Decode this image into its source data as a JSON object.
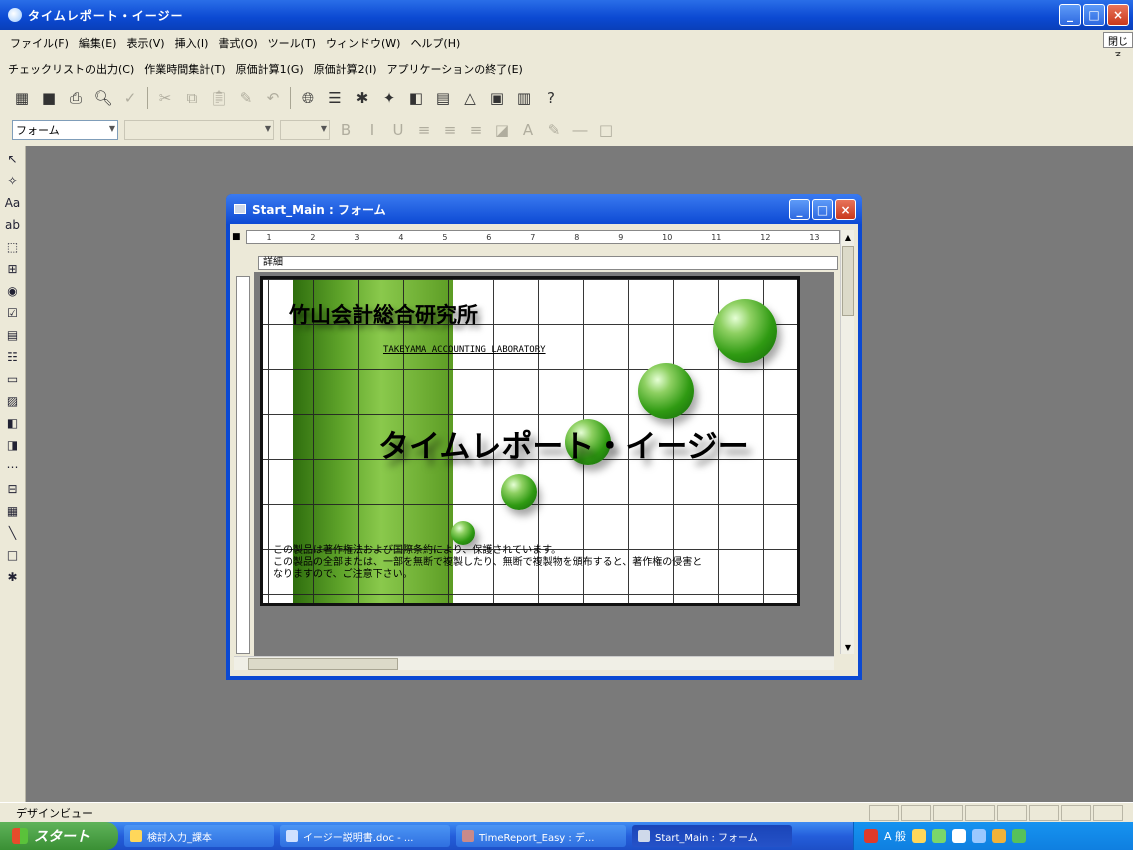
{
  "app": {
    "title": "タイムレポート・イージー"
  },
  "window_buttons": {
    "minimize": "_",
    "maximize": "□",
    "close": "×"
  },
  "menu": [
    "ファイル(F)",
    "編集(E)",
    "表示(V)",
    "挿入(I)",
    "書式(O)",
    "ツール(T)",
    "ウィンドウ(W)",
    "ヘルプ(H)"
  ],
  "ime_close": "閉じる",
  "addin_menu": [
    "チェックリストの出力(C)",
    "作業時間集計(T)",
    "原価計算1(G)",
    "原価計算2(I)",
    "アプリケーションの終了(E)"
  ],
  "format_toolbar": {
    "object_combo": "フォーム"
  },
  "form_window": {
    "title": "Start_Main : フォーム",
    "section": "詳細",
    "ruler_marks": [
      "1",
      "2",
      "3",
      "4",
      "5",
      "6",
      "7",
      "8",
      "9",
      "10",
      "11",
      "12",
      "13"
    ]
  },
  "splash": {
    "company": "竹山会計総合研究所",
    "company_en": "TAKEYAMA ACCOUNTING LABORATORY",
    "title": "タイムレポート・イージー",
    "notice_lines": [
      "この製品は著作権法および国際条約により、保護されています。",
      "この製品の全部または、一部を無断で複製したり、無断で複製物を頒布すると、著作権の侵害と",
      "なりますので、ご注意下さい。"
    ]
  },
  "status": {
    "text": "デザインビュー"
  },
  "taskbar": {
    "start": "スタート",
    "tasks": [
      "検討入力_課本",
      "イージー説明書.doc - ...",
      "TimeReport_Easy : デ...",
      "Start_Main : フォーム"
    ],
    "tray_text": "A 般"
  },
  "colors": {
    "titlebar": "#0b49d2",
    "chrome": "#ece9d8",
    "workspace": "#7a7a7a",
    "green": "#5fa42a"
  }
}
